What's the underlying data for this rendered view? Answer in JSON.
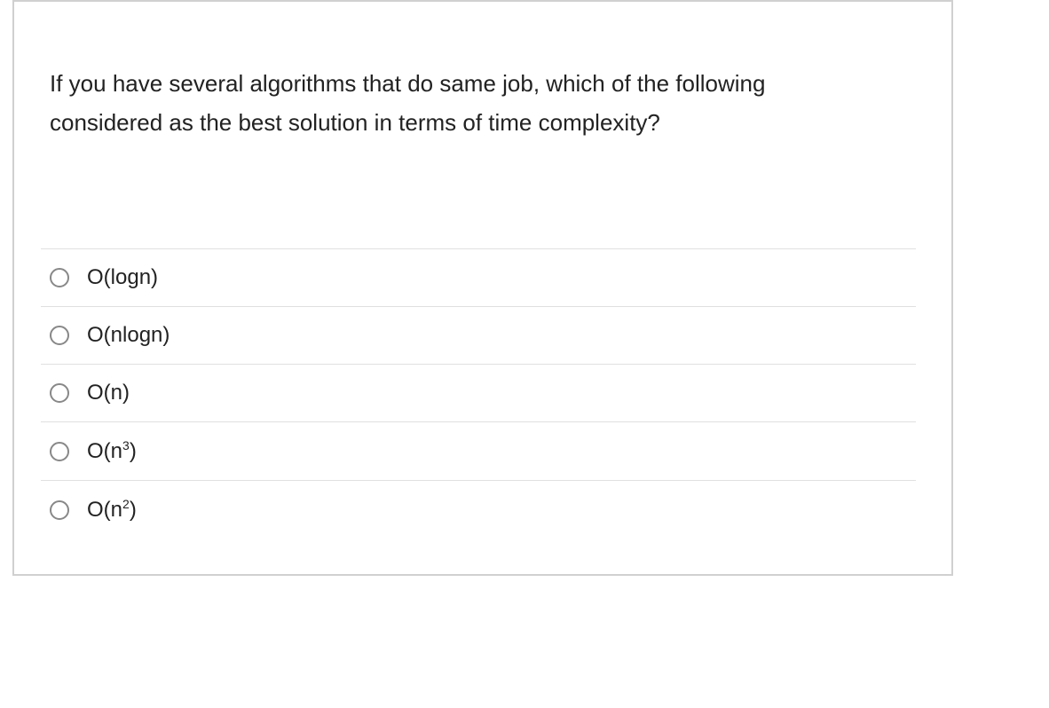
{
  "question": {
    "text": "If you have several algorithms that do same job, which of the following considered as the best solution in terms of time complexity?"
  },
  "options": [
    {
      "label": "O(logn)",
      "sup": ""
    },
    {
      "label": "O(nlogn)",
      "sup": ""
    },
    {
      "label": "O(n)",
      "sup": ""
    },
    {
      "label_base": "O(n",
      "sup": "3",
      "label_close": ")"
    },
    {
      "label_base": "O(n",
      "sup": "2",
      "label_close": ")"
    }
  ]
}
